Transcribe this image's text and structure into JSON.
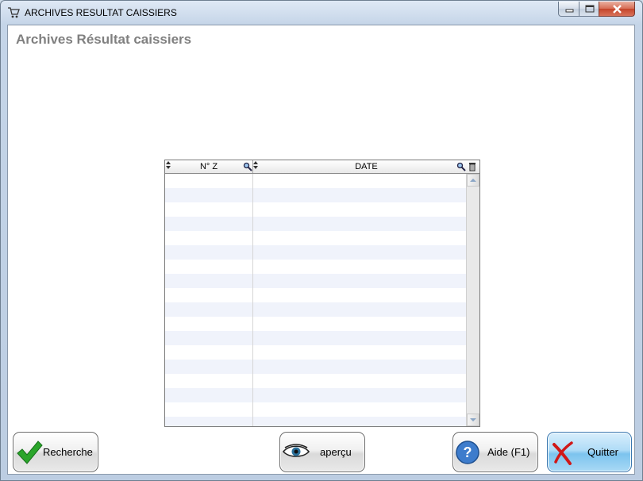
{
  "window": {
    "title": "ARCHIVES RESULTAT CAISSIERS",
    "icon": "shopping-cart-icon"
  },
  "page": {
    "heading": "Archives Résultat caissiers"
  },
  "grid": {
    "columns": [
      {
        "label": "N° Z",
        "icons": [
          "sort-icon",
          "search-icon"
        ]
      },
      {
        "label": "DATE",
        "icons": [
          "sort-icon",
          "search-icon",
          "trash-icon"
        ]
      }
    ],
    "rows": [],
    "row_stripe_color": "#f0f3fb"
  },
  "buttons": {
    "recherche": {
      "label": "Recherche",
      "icon": "checkmark-icon"
    },
    "apercu": {
      "label": "aperçu",
      "icon": "eye-icon"
    },
    "aide": {
      "label": "Aide (F1)",
      "icon": "help-icon"
    },
    "quitter": {
      "label": "Quitter",
      "icon": "red-x-icon"
    }
  },
  "colors": {
    "heading": "#808080",
    "quit_button": "#7cc3ee",
    "close_button": "#c4442a"
  }
}
